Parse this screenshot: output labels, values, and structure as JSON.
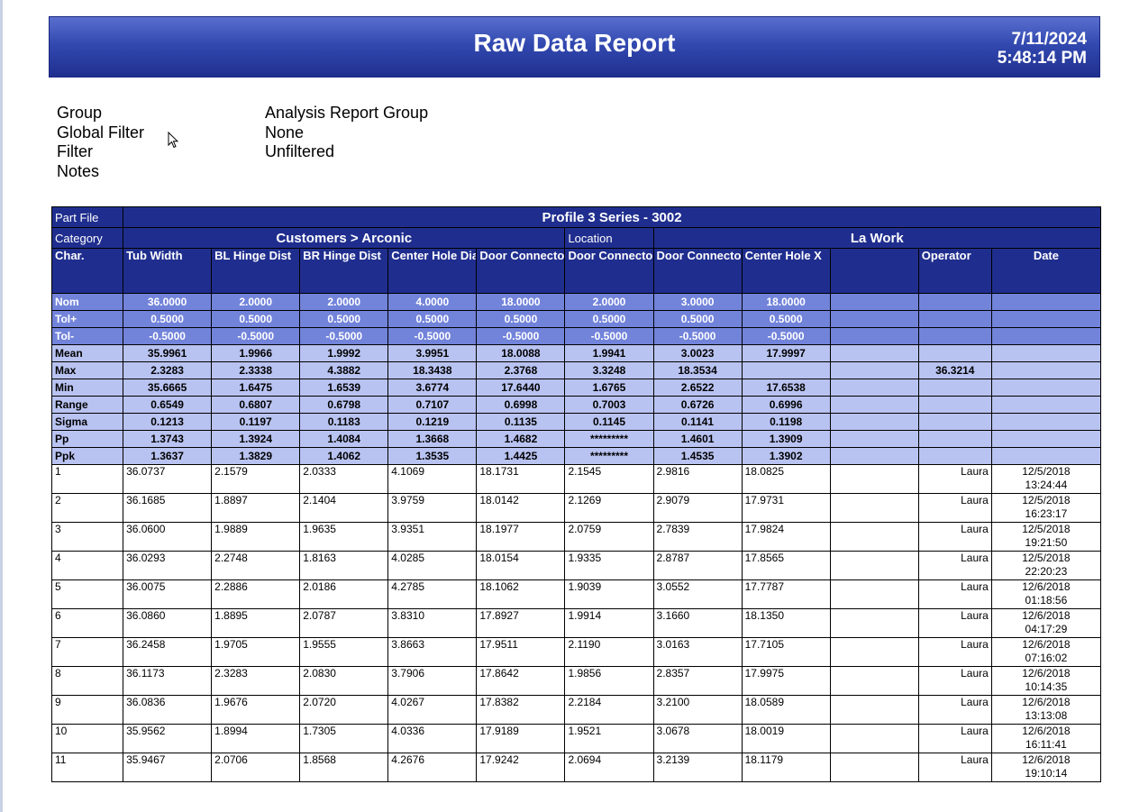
{
  "header": {
    "title": "Raw Data Report",
    "date": "7/11/2024",
    "time": "5:48:14 PM"
  },
  "info": {
    "labels": [
      "Group",
      "Global Filter",
      "Filter",
      "Notes"
    ],
    "values": [
      "Analysis Report Group",
      "None",
      "Unfiltered",
      ""
    ]
  },
  "report": {
    "part_file_label": "Part File",
    "part_file": "Profile 3 Series - 3002",
    "category_label": "Category",
    "category": "Customers > Arconic",
    "location_label": "Location",
    "location": "La Work",
    "columns": [
      "Char.",
      "Tub Width",
      "BL Hinge Dist",
      "BR Hinge Dist",
      "Center Hole Dia",
      "Door Connector Slot X",
      "Door Connector Slot Y",
      "Door Connector Slot Width",
      "Center Hole X",
      "",
      "Operator",
      "Date"
    ],
    "tol_rows": [
      [
        "Nom",
        "36.0000",
        "2.0000",
        "2.0000",
        "4.0000",
        "18.0000",
        "2.0000",
        "3.0000",
        "18.0000",
        "",
        "",
        ""
      ],
      [
        "Tol+",
        "0.5000",
        "0.5000",
        "0.5000",
        "0.5000",
        "0.5000",
        "0.5000",
        "0.5000",
        "0.5000",
        "",
        "",
        ""
      ],
      [
        "Tol-",
        "-0.5000",
        "-0.5000",
        "-0.5000",
        "-0.5000",
        "-0.5000",
        "-0.5000",
        "-0.5000",
        "-0.5000",
        "",
        "",
        ""
      ]
    ],
    "stat_rows": [
      [
        "Mean",
        "35.9961",
        "1.9966",
        "1.9992",
        "3.9951",
        "18.0088",
        "1.9941",
        "3.0023",
        "17.9997",
        "",
        "",
        ""
      ],
      [
        "Max",
        "2.3283",
        "2.3338",
        "4.3882",
        "18.3438",
        "2.3768",
        "3.3248",
        "18.3534",
        "",
        "",
        "36.3214",
        ""
      ],
      [
        "Min",
        "35.6665",
        "1.6475",
        "1.6539",
        "3.6774",
        "17.6440",
        "1.6765",
        "2.6522",
        "17.6538",
        "",
        "",
        ""
      ],
      [
        "Range",
        "0.6549",
        "0.6807",
        "0.6798",
        "0.7107",
        "0.6998",
        "0.7003",
        "0.6726",
        "0.6996",
        "",
        "",
        ""
      ],
      [
        "Sigma",
        "0.1213",
        "0.1197",
        "0.1183",
        "0.1219",
        "0.1135",
        "0.1145",
        "0.1141",
        "0.1198",
        "",
        "",
        ""
      ],
      [
        "Pp",
        "1.3743",
        "1.3924",
        "1.4084",
        "1.3668",
        "1.4682",
        "*********",
        "1.4601",
        "1.3909",
        "",
        "",
        ""
      ],
      [
        "Ppk",
        "1.3637",
        "1.3829",
        "1.4062",
        "1.3535",
        "1.4425",
        "*********",
        "1.4535",
        "1.3902",
        "",
        "",
        ""
      ]
    ],
    "data_rows": [
      [
        "1",
        "36.0737",
        "2.1579",
        "2.0333",
        "4.1069",
        "18.1731",
        "2.1545",
        "2.9816",
        "18.0825",
        "",
        "Laura",
        "12/5/2018",
        "13:24:44"
      ],
      [
        "2",
        "36.1685",
        "1.8897",
        "2.1404",
        "3.9759",
        "18.0142",
        "2.1269",
        "2.9079",
        "17.9731",
        "",
        "Laura",
        "12/5/2018",
        "16:23:17"
      ],
      [
        "3",
        "36.0600",
        "1.9889",
        "1.9635",
        "3.9351",
        "18.1977",
        "2.0759",
        "2.7839",
        "17.9824",
        "",
        "Laura",
        "12/5/2018",
        "19:21:50"
      ],
      [
        "4",
        "36.0293",
        "2.2748",
        "1.8163",
        "4.0285",
        "18.0154",
        "1.9335",
        "2.8787",
        "17.8565",
        "",
        "Laura",
        "12/5/2018",
        "22:20:23"
      ],
      [
        "5",
        "36.0075",
        "2.2886",
        "2.0186",
        "4.2785",
        "18.1062",
        "1.9039",
        "3.0552",
        "17.7787",
        "",
        "Laura",
        "12/6/2018",
        "01:18:56"
      ],
      [
        "6",
        "36.0860",
        "1.8895",
        "2.0787",
        "3.8310",
        "17.8927",
        "1.9914",
        "3.1660",
        "18.1350",
        "",
        "Laura",
        "12/6/2018",
        "04:17:29"
      ],
      [
        "7",
        "36.2458",
        "1.9705",
        "1.9555",
        "3.8663",
        "17.9511",
        "2.1190",
        "3.0163",
        "17.7105",
        "",
        "Laura",
        "12/6/2018",
        "07:16:02"
      ],
      [
        "8",
        "36.1173",
        "2.3283",
        "2.0830",
        "3.7906",
        "17.8642",
        "1.9856",
        "2.8357",
        "17.9975",
        "",
        "Laura",
        "12/6/2018",
        "10:14:35"
      ],
      [
        "9",
        "36.0836",
        "1.9676",
        "2.0720",
        "4.0267",
        "17.8382",
        "2.2184",
        "3.2100",
        "18.0589",
        "",
        "Laura",
        "12/6/2018",
        "13:13:08"
      ],
      [
        "10",
        "35.9562",
        "1.8994",
        "1.7305",
        "4.0336",
        "17.9189",
        "1.9521",
        "3.0678",
        "18.0019",
        "",
        "Laura",
        "12/6/2018",
        "16:11:41"
      ],
      [
        "11",
        "35.9467",
        "2.0706",
        "1.8568",
        "4.2676",
        "17.9242",
        "2.0694",
        "3.2139",
        "18.1179",
        "",
        "Laura",
        "12/6/2018",
        "19:10:14"
      ]
    ]
  }
}
